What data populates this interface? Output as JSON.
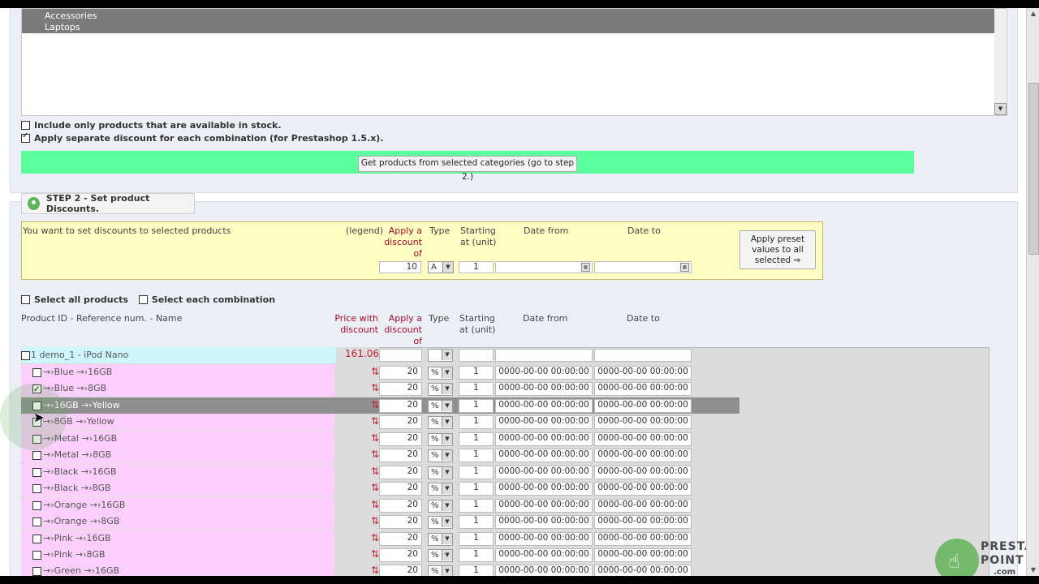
{
  "step1": {
    "categories": [
      "Accessories",
      "Laptops"
    ],
    "option_in_stock": {
      "label": "Include only products that are available in stock.",
      "checked": false
    },
    "option_separate": {
      "label": "Apply separate discount for each combination (for Prestashop 1.5.x).",
      "checked": true
    },
    "get_products_label": "Get products from selected categories (go to step 2.)"
  },
  "step2": {
    "title": "STEP 2 - Set product Discounts.",
    "legend": {
      "intro": "You want to set discounts to selected products",
      "legend_label": "(legend)",
      "col_discount": "Apply a discount of",
      "col_type": "Type",
      "col_start": "Starting at (unit)",
      "col_from": "Date from",
      "col_to": "Date to",
      "discount_value": "10",
      "type_value": "A",
      "start_value": "1",
      "preset_button": "Apply preset values to all selected ⇒"
    },
    "select_all": "Select all products",
    "select_each": "Select each combination",
    "table": {
      "col_product": "Product ID - Reference num. - Name",
      "col_price": "Price with discount",
      "col_discount": "Apply a discount of",
      "col_type": "Type",
      "col_start": "Starting at (unit)",
      "col_from": "Date from",
      "col_to": "Date to"
    },
    "product": {
      "name": "1 demo_1 - iPod Nano",
      "price": "161.06"
    },
    "combinations": [
      {
        "name": "→›Blue →›16GB",
        "checked": false,
        "discount": "20",
        "type": "%",
        "start": "1",
        "from": "0000-00-00 00:00:00",
        "to": "0000-00-00 00:00:00"
      },
      {
        "name": "→›Blue →›8GB",
        "checked": true,
        "discount": "20",
        "type": "%",
        "start": "1",
        "from": "0000-00-00 00:00:00",
        "to": "0000-00-00 00:00:00"
      },
      {
        "name": "→›16GB →›Yellow",
        "checked": false,
        "discount": "20",
        "type": "%",
        "start": "1",
        "from": "0000-00-00 00:00:00",
        "to": "0000-00-00 00:00:00",
        "highlighted": true
      },
      {
        "name": "→›8GB →›Yellow",
        "checked": false,
        "discount": "20",
        "type": "%",
        "start": "1",
        "from": "0000-00-00 00:00:00",
        "to": "0000-00-00 00:00:00"
      },
      {
        "name": "→›Metal →›16GB",
        "checked": false,
        "discount": "20",
        "type": "%",
        "start": "1",
        "from": "0000-00-00 00:00:00",
        "to": "0000-00-00 00:00:00"
      },
      {
        "name": "→›Metal →›8GB",
        "checked": false,
        "discount": "20",
        "type": "%",
        "start": "1",
        "from": "0000-00-00 00:00:00",
        "to": "0000-00-00 00:00:00"
      },
      {
        "name": "→›Black →›16GB",
        "checked": false,
        "discount": "20",
        "type": "%",
        "start": "1",
        "from": "0000-00-00 00:00:00",
        "to": "0000-00-00 00:00:00"
      },
      {
        "name": "→›Black →›8GB",
        "checked": false,
        "discount": "20",
        "type": "%",
        "start": "1",
        "from": "0000-00-00 00:00:00",
        "to": "0000-00-00 00:00:00"
      },
      {
        "name": "→›Orange →›16GB",
        "checked": false,
        "discount": "20",
        "type": "%",
        "start": "1",
        "from": "0000-00-00 00:00:00",
        "to": "0000-00-00 00:00:00"
      },
      {
        "name": "→›Orange →›8GB",
        "checked": false,
        "discount": "20",
        "type": "%",
        "start": "1",
        "from": "0000-00-00 00:00:00",
        "to": "0000-00-00 00:00:00"
      },
      {
        "name": "→›Pink →›16GB",
        "checked": false,
        "discount": "20",
        "type": "%",
        "start": "1",
        "from": "0000-00-00 00:00:00",
        "to": "0000-00-00 00:00:00"
      },
      {
        "name": "→›Pink →›8GB",
        "checked": false,
        "discount": "20",
        "type": "%",
        "start": "1",
        "from": "0000-00-00 00:00:00",
        "to": "0000-00-00 00:00:00"
      },
      {
        "name": "→›Green →›16GB",
        "checked": false,
        "discount": "20",
        "type": "%",
        "start": "1",
        "from": "0000-00-00 00:00:00",
        "to": "0000-00-00 00:00:00"
      }
    ],
    "sort_icon": "⇅"
  },
  "brand": {
    "line1": "PRESTA",
    "line2": "POINT",
    "line3": ".com"
  },
  "colors": {
    "accent_green": "#5cff9d",
    "row_pink": "#fccffc",
    "legend_yellow": "#ffffc4",
    "price_red": "#c0223a"
  }
}
